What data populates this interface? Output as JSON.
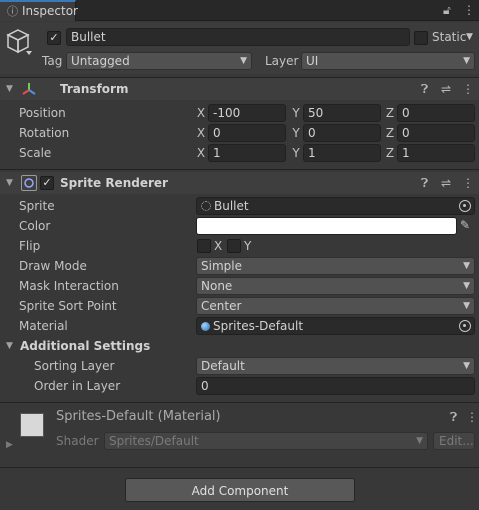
{
  "tab": {
    "title": "Inspector"
  },
  "gameobject": {
    "name": "Bullet",
    "static_label": "Static",
    "tag_label": "Tag",
    "tag_value": "Untagged",
    "layer_label": "Layer",
    "layer_value": "UI"
  },
  "transform": {
    "title": "Transform",
    "rows": [
      {
        "label": "Position",
        "x": "-100",
        "y": "50",
        "z": "0"
      },
      {
        "label": "Rotation",
        "x": "0",
        "y": "0",
        "z": "0"
      },
      {
        "label": "Scale",
        "x": "1",
        "y": "1",
        "z": "1"
      }
    ],
    "axis": {
      "x": "X",
      "y": "Y",
      "z": "Z"
    }
  },
  "sprite_renderer": {
    "title": "Sprite Renderer",
    "sprite_label": "Sprite",
    "sprite_value": "Bullet",
    "color_label": "Color",
    "color_value": "#ffffff",
    "flip_label": "Flip",
    "flip_x": "X",
    "flip_y": "Y",
    "draw_mode_label": "Draw Mode",
    "draw_mode_value": "Simple",
    "mask_label": "Mask Interaction",
    "mask_value": "None",
    "sort_point_label": "Sprite Sort Point",
    "sort_point_value": "Center",
    "material_label": "Material",
    "material_value": "Sprites-Default",
    "additional_label": "Additional Settings",
    "sorting_layer_label": "Sorting Layer",
    "sorting_layer_value": "Default",
    "order_label": "Order in Layer",
    "order_value": "0"
  },
  "material": {
    "title": "Sprites-Default (Material)",
    "shader_label": "Shader",
    "shader_value": "Sprites/Default",
    "edit_label": "Edit..."
  },
  "add_component": {
    "label": "Add Component"
  },
  "colors": {
    "accent": "#3a79bb",
    "background": "#383838",
    "field": "#2a2a2a"
  }
}
